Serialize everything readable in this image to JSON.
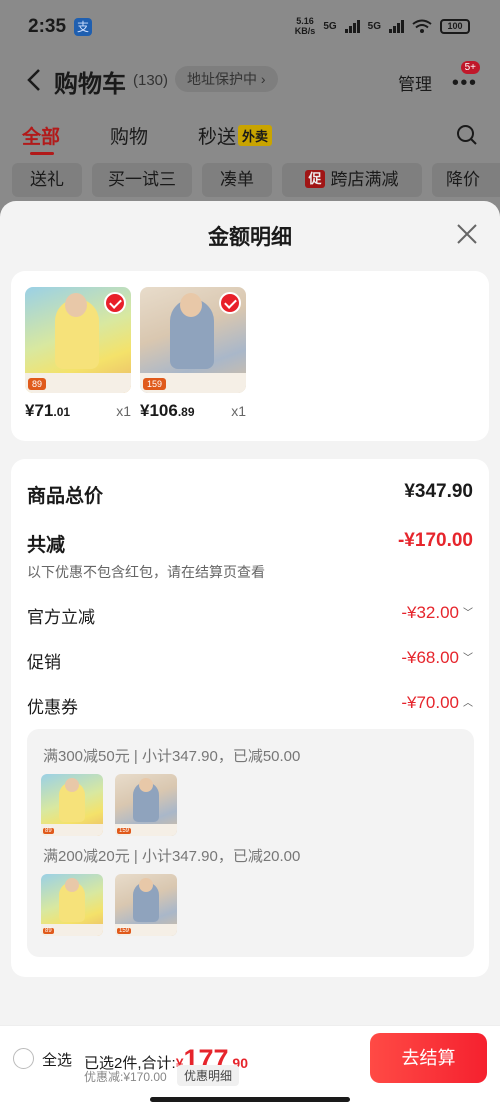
{
  "status_bar": {
    "time": "2:35",
    "alipay": "支",
    "speed_top": "5.16",
    "speed_bottom": "KB/s",
    "net1": "5G",
    "net2": "5G",
    "battery": "100"
  },
  "nav": {
    "title": "购物车",
    "count": "(130)",
    "address": "地址保护中 ›",
    "manage": "管理",
    "more_badge": "5+"
  },
  "tabs": {
    "all": "全部",
    "shop": "购物",
    "express": "秒送",
    "waimai": "外卖"
  },
  "filters": {
    "gift": "送礼",
    "try": "买一试三",
    "bundle": "凑单",
    "promo_tag": "促",
    "cross_store": "跨店满减",
    "price_drop": "降价"
  },
  "sheet": {
    "title": "金额明细"
  },
  "items": [
    {
      "price_int": "¥71",
      "price_dec": ".01",
      "qty": "x1",
      "thumb_price": "89"
    },
    {
      "price_int": "¥106",
      "price_dec": ".89",
      "qty": "x1",
      "thumb_price": "159"
    }
  ],
  "detail": {
    "total_label": "商品总价",
    "total_value": "¥347.90",
    "reduce_label": "共减",
    "reduce_value": "-¥170.00",
    "note": "以下优惠不包含红包，请在结算页查看",
    "official_label": "官方立减",
    "official_value": "-¥32.00",
    "promo_label": "促销",
    "promo_value": "-¥68.00",
    "coupon_label": "优惠券",
    "coupon_value": "-¥70.00"
  },
  "coupons": [
    {
      "text": "满300减50元 | 小计347.90，已减50.00",
      "thumb_prices": [
        "89",
        "159"
      ]
    },
    {
      "text": "满200减20元 | 小计347.90，已减20.00",
      "thumb_prices": [
        "89",
        "159"
      ]
    }
  ],
  "checkout": {
    "select_all": "全选",
    "summary_prefix": "已选2件,合计:",
    "yen": "¥",
    "total_int": "177",
    "total_dec": ".90",
    "discount": "优惠减:¥170.00",
    "detail_link": "优惠明细",
    "button": "去结算"
  },
  "colors": {
    "accent": "#e6252c",
    "brand_red": "#b21a1a"
  }
}
